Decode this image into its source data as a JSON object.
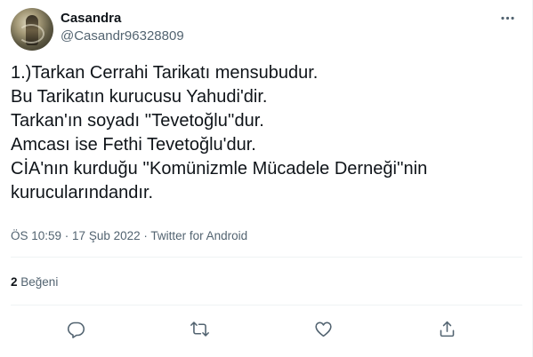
{
  "author": {
    "display_name": "Casandra",
    "username": "@Casandr96328809",
    "avatar_icon": "user-avatar"
  },
  "tweet": {
    "lines": [
      "1.)Tarkan Cerrahi Tarikatı mensubudur.",
      "Bu Tarikatın kurucusu Yahudi'dir.",
      "Tarkan'ın soyadı ''Tevetoğlu''dur.",
      "Amcası ise Fethi Tevetoğlu'dur.",
      "CİA'nın kurduğu ''Komünizmle Mücadele Derneği''nin",
      "kurucularındandır."
    ]
  },
  "meta": {
    "time": "ÖS 10:59",
    "separator": " · ",
    "date": "17 Şub 2022",
    "source": "Twitter for Android"
  },
  "stats": {
    "likes_count": "2",
    "likes_label": "Beğeni"
  },
  "icons": {
    "more": "more-icon",
    "reply": "reply-icon",
    "retweet": "retweet-icon",
    "like": "like-icon",
    "share": "share-icon"
  },
  "colors": {
    "text_primary": "#0f1419",
    "text_secondary": "#536471",
    "divider": "#eff3f4"
  }
}
